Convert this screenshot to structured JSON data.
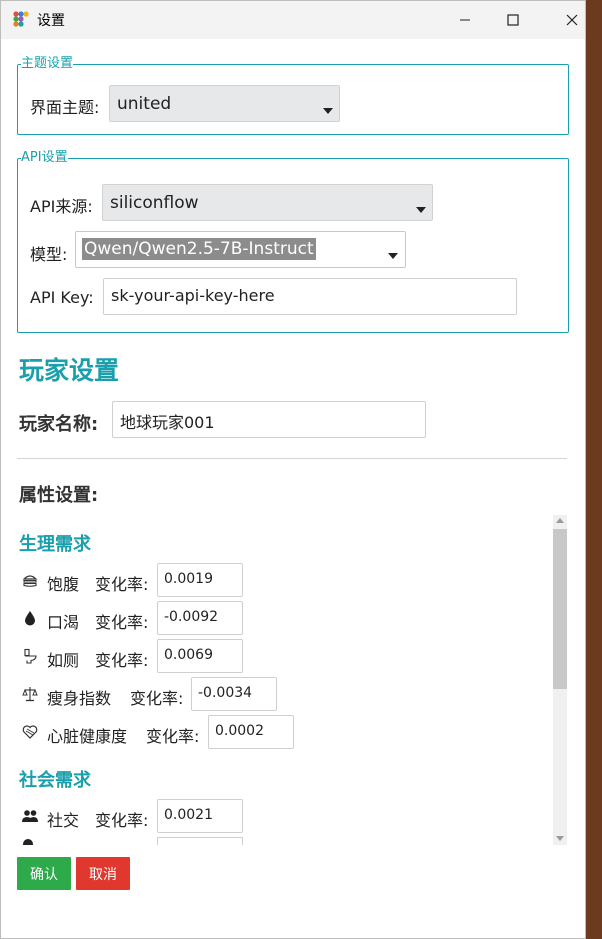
{
  "window": {
    "title": "设置"
  },
  "theme_group": {
    "legend": "主题设置",
    "label": "界面主题:",
    "value": "united"
  },
  "api_group": {
    "legend": "API设置",
    "source_label": "API来源:",
    "source_value": "siliconflow",
    "model_label": "模型:",
    "model_value": "Qwen/Qwen2.5-7B-Instruct",
    "key_label": "API Key:",
    "key_value": "sk-your-api-key-here"
  },
  "player": {
    "heading": "玩家设置",
    "name_label": "玩家名称:",
    "name_value": "地球玩家001",
    "attributes_label": "属性设置:"
  },
  "physiological": {
    "heading": "生理需求",
    "rate_label": "变化率:",
    "items": [
      {
        "icon": "burger-icon",
        "name": "饱腹",
        "rate": "0.0019"
      },
      {
        "icon": "droplet-icon",
        "name": "口渴",
        "rate": "-0.0092"
      },
      {
        "icon": "toilet-icon",
        "name": "如厕",
        "rate": "0.0069"
      },
      {
        "icon": "scale-icon",
        "name": "瘦身指数",
        "rate": "-0.0034"
      },
      {
        "icon": "heart-icon",
        "name": "心脏健康度",
        "rate": "0.0002"
      }
    ]
  },
  "social": {
    "heading": "社会需求",
    "rate_label": "变化率:",
    "items": [
      {
        "icon": "people-icon",
        "name": "社交",
        "rate": "0.0021"
      }
    ]
  },
  "buttons": {
    "ok": "确认",
    "cancel": "取消"
  },
  "colors": {
    "accent": "#1a9fad",
    "ok": "#2eaa4a",
    "cancel": "#e0382e"
  }
}
